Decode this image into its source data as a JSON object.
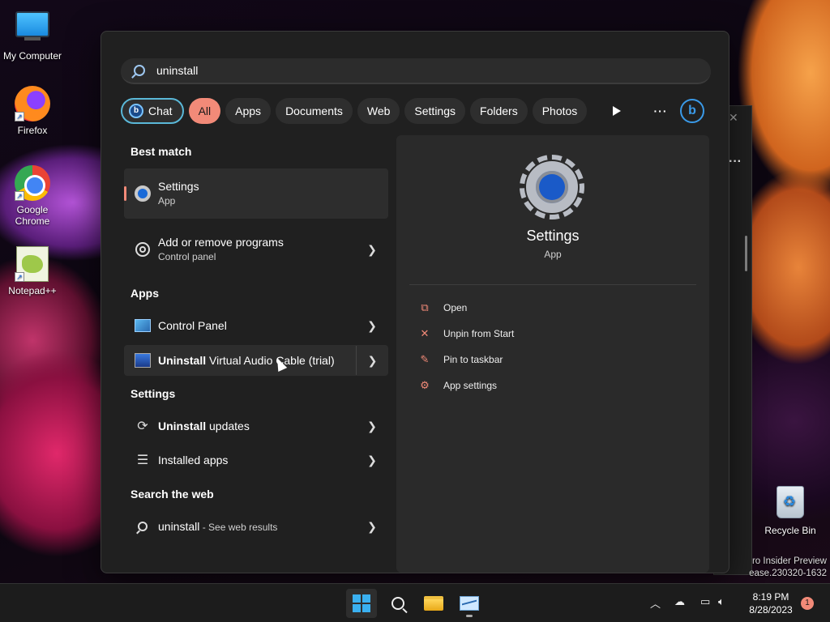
{
  "desktop": {
    "icons": [
      {
        "label": "My Computer",
        "icon": "monitor-icon"
      },
      {
        "label": "Firefox",
        "icon": "firefox-icon"
      },
      {
        "label": "Google Chrome",
        "icon": "chrome-icon"
      },
      {
        "label": "Notepad++",
        "icon": "notepadpp-icon"
      },
      {
        "label": "Recycle Bin",
        "icon": "recycle-bin-icon"
      }
    ],
    "watermark_line1": "ro Insider Preview",
    "watermark_line2": "ease.230320-1632"
  },
  "search": {
    "value": "uninstall"
  },
  "filters": {
    "chat": "Chat",
    "all": "All",
    "apps": "Apps",
    "documents": "Documents",
    "web": "Web",
    "settings": "Settings",
    "folders": "Folders",
    "photos": "Photos",
    "more": "···",
    "bing_letter": "b",
    "chat_letter": "b",
    "active_color": "#f28a78"
  },
  "results": {
    "best_match_title": "Best match",
    "best_match": {
      "title": "Settings",
      "subtitle": "App"
    },
    "add_remove": {
      "title": "Add or remove programs",
      "subtitle": "Control panel"
    },
    "apps_title": "Apps",
    "control_panel": "Control Panel",
    "vac_bold": "Uninstall",
    "vac_rest": " Virtual Audio Cable (trial)",
    "settings_title": "Settings",
    "updates_bold": "Uninstall",
    "updates_rest": " updates",
    "installed_apps": "Installed apps",
    "web_title": "Search the web",
    "web_query": "uninstall",
    "web_hint": " - See web results"
  },
  "preview": {
    "title": "Settings",
    "subtitle": "App",
    "actions": [
      {
        "label": "Open",
        "icon": "open-external-icon"
      },
      {
        "label": "Unpin from Start",
        "icon": "unpin-icon"
      },
      {
        "label": "Pin to taskbar",
        "icon": "pin-icon"
      },
      {
        "label": "App settings",
        "icon": "gear-icon"
      }
    ]
  },
  "taskbar": {
    "time": "8:19 PM",
    "date": "8/28/2023",
    "notifications": "1"
  }
}
